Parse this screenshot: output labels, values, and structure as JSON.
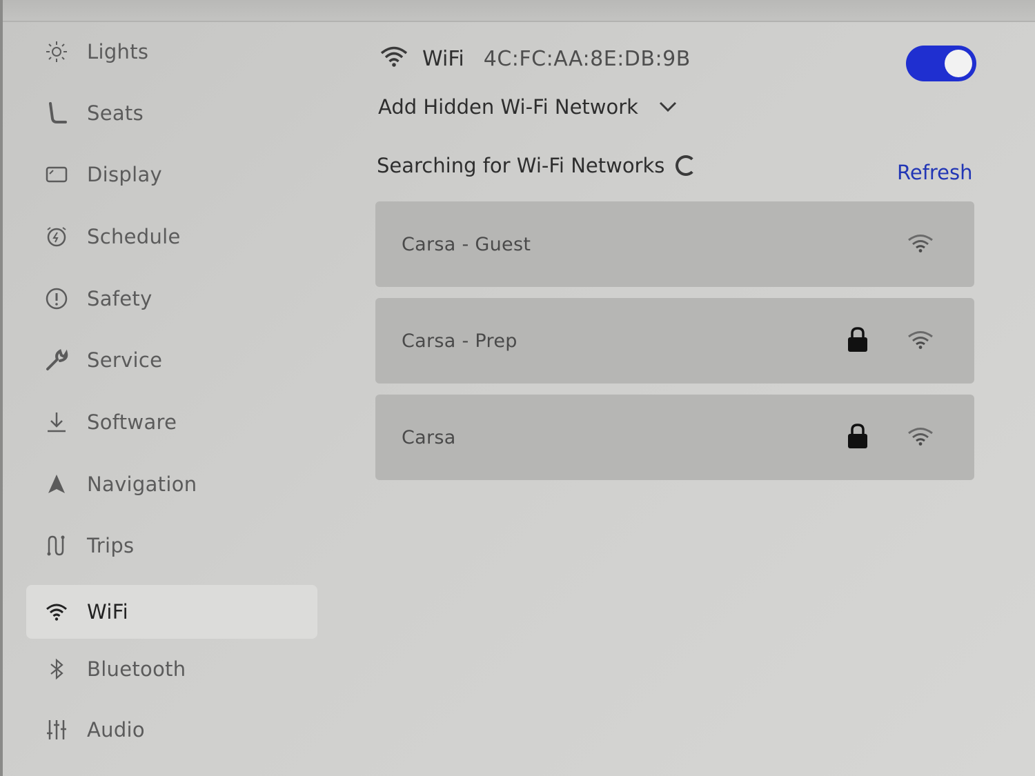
{
  "sidebar": {
    "items": [
      {
        "label": "Lights",
        "icon": "sun-icon"
      },
      {
        "label": "Seats",
        "icon": "seat-icon"
      },
      {
        "label": "Display",
        "icon": "display-icon"
      },
      {
        "label": "Schedule",
        "icon": "alarm-clock-icon"
      },
      {
        "label": "Safety",
        "icon": "alert-circle-icon"
      },
      {
        "label": "Service",
        "icon": "wrench-icon"
      },
      {
        "label": "Software",
        "icon": "download-icon"
      },
      {
        "label": "Navigation",
        "icon": "navigation-arrow-icon"
      },
      {
        "label": "Trips",
        "icon": "trips-icon"
      },
      {
        "label": "WiFi",
        "icon": "wifi-icon",
        "active": true
      },
      {
        "label": "Bluetooth",
        "icon": "bluetooth-icon"
      },
      {
        "label": "Audio",
        "icon": "audio-sliders-icon"
      }
    ]
  },
  "main": {
    "title": "WiFi",
    "mac_address": "4C:FC:AA:8E:DB:9B",
    "wifi_enabled": true,
    "add_hidden_label": "Add Hidden Wi-Fi Network",
    "searching_label": "Searching for Wi-Fi Networks",
    "refresh_label": "Refresh",
    "networks": [
      {
        "name": "Carsa - Guest",
        "secured": false
      },
      {
        "name": "Carsa - Prep",
        "secured": true
      },
      {
        "name": "Carsa",
        "secured": true
      }
    ]
  },
  "colors": {
    "accent": "#1f2fd0",
    "refresh_link": "#2236b5",
    "background": "#cfcfcd",
    "network_row": "#b6b6b4",
    "active_item": "#dcdcda"
  }
}
